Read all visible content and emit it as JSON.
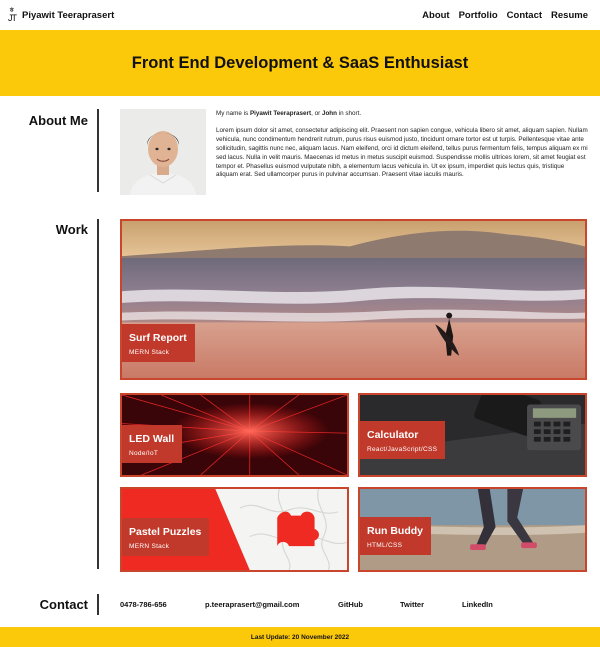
{
  "nav": {
    "logo_top": "ㅎ",
    "logo_bottom": "JT",
    "brand": "Piyawit Teeraprasert",
    "links": [
      "About",
      "Portfolio",
      "Contact",
      "Resume"
    ]
  },
  "hero": {
    "title": "Front End Development & SaaS Enthusiast"
  },
  "about": {
    "heading": "About Me",
    "intro_prefix": "My name is ",
    "intro_name": "Piyawit Teeraprasert",
    "intro_mid": ", or ",
    "intro_nick": "John",
    "intro_suffix": " in short.",
    "body": "Lorem ipsum dolor sit amet, consectetur adipiscing elit. Praesent non sapien congue, vehicula libero sit amet, aliquam sapien. Nullam vehicula, nunc condimentum hendrerit rutrum, purus risus euismod justo, tincidunt ornare tortor est ut turpis. Pellentesque vitae ante sollicitudin, sagittis nunc nec, aliquam lacus. Nam eleifend, orci id dictum eleifend, tellus purus fermentum felis, tempus aliquam ex mi sed lacus. Nulla in velit mauris. Maecenas id metus in metus suscipit euismod. Suspendisse mollis ultrices lorem, sit amet feugiat est tempor et. Phasellus euismod vulputate nibh, a elementum lacus vehicula in. Ut ex ipsum, imperdiet quis lectus quis, tristique aliquam erat. Sed ullamcorper purus in pulvinar accumsan. Praesent vitae iaculis mauris."
  },
  "work": {
    "heading": "Work",
    "projects": [
      {
        "title": "Surf Report",
        "stack": "MERN Stack"
      },
      {
        "title": "LED Wall",
        "stack": "Node/IoT"
      },
      {
        "title": "Calculator",
        "stack": "React/JavaScript/CSS"
      },
      {
        "title": "Pastel Puzzles",
        "stack": "MERN Stack"
      },
      {
        "title": "Run Buddy",
        "stack": "HTML/CSS"
      }
    ]
  },
  "contact": {
    "heading": "Contact",
    "phone": "0478-786-656",
    "email": "p.teeraprasert@gmail.com",
    "github": "GitHub",
    "twitter": "Twitter",
    "linkedin": "LinkedIn"
  },
  "footer": {
    "text": "Last Update: 20 November 2022"
  },
  "colors": {
    "accent": "#fcc80a",
    "card_red": "#c0392b",
    "border_red": "#c9452b"
  }
}
